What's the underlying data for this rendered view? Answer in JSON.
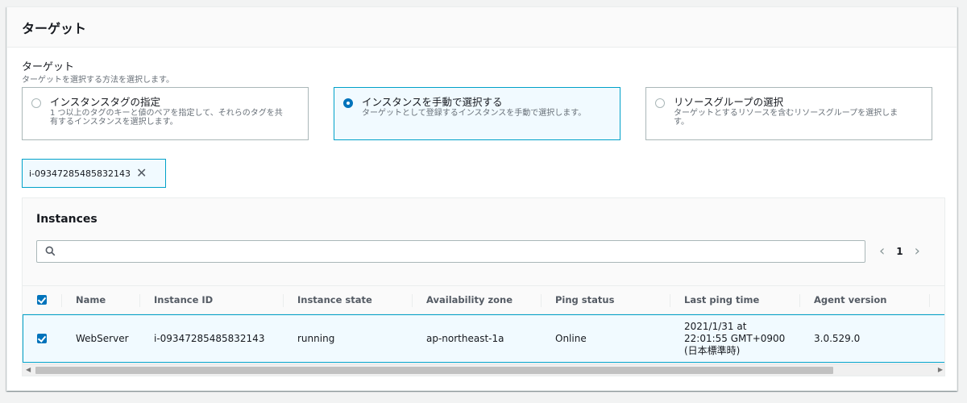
{
  "header": {
    "title": "ターゲット"
  },
  "target_section": {
    "label": "ターゲット",
    "description": "ターゲットを選択する方法を選択します。",
    "options": [
      {
        "title": "インスタンスタグの指定",
        "desc_line1": "1 つ以上のタグのキーと値のペアを指定して、それらのタグを共",
        "desc_line2": "有するインスタンスを選択します。",
        "selected": false
      },
      {
        "title": "インスタンスを手動で選択する",
        "desc_line1": "ターゲットとして登録するインスタンスを手動で選択します。",
        "desc_line2": "",
        "selected": true
      },
      {
        "title": "リソースグループの選択",
        "desc_line1": "ターゲットとするリソースを含むリソースグループを選択しま",
        "desc_line2": "す。",
        "selected": false
      }
    ]
  },
  "selected_token": {
    "label": "i-09347285485832143"
  },
  "instances_table": {
    "title": "Instances",
    "search": {
      "placeholder": "",
      "value": ""
    },
    "pagination": {
      "current_page": "1"
    },
    "columns": [
      "Name",
      "Instance ID",
      "Instance state",
      "Availability zone",
      "Ping status",
      "Last ping time",
      "Agent version"
    ],
    "rows": [
      {
        "selected": true,
        "name": "WebServer",
        "instance_id": "i-09347285485832143",
        "instance_state": "running",
        "availability_zone": "ap-northeast-1a",
        "ping_status": "Online",
        "last_ping_time_line1": "2021/1/31 at",
        "last_ping_time_line2": "22:01:55 GMT+0900",
        "last_ping_time_line3": "(日本標準時)",
        "agent_version": "3.0.529.0"
      }
    ]
  },
  "colors": {
    "accent": "#0073bb",
    "selected_border": "#00a1c9",
    "selected_bg": "#f1faff"
  }
}
